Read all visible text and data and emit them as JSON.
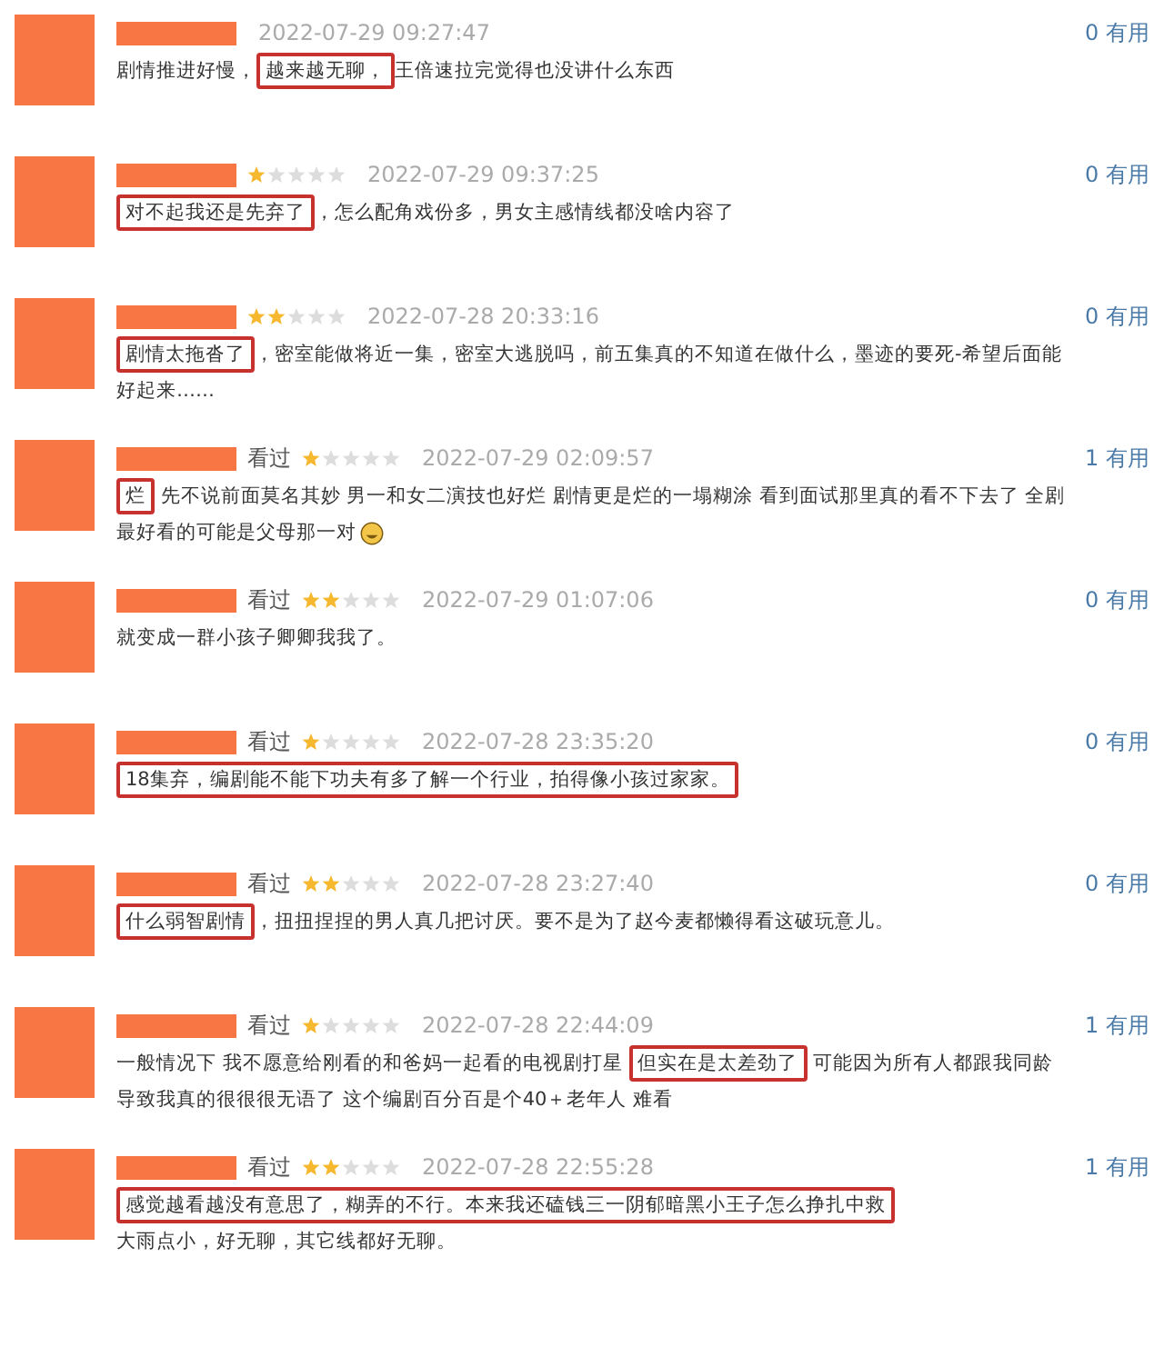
{
  "comments": [
    {
      "date": "2022-07-29 09:27:47",
      "useful": "0 有用",
      "lines": [
        {
          "segments": [
            {
              "text": "剧情推进好慢，",
              "boxed": false
            },
            {
              "text": "越来越无聊，",
              "boxed": true
            },
            {
              "text": "王倍速拉完觉得也没讲什么东西",
              "boxed": false
            }
          ]
        }
      ]
    },
    {
      "stars": 1,
      "date": "2022-07-29 09:37:25",
      "useful": "0 有用",
      "lines": [
        {
          "segments": [
            {
              "text": "对不起我还是先弃了",
              "boxed": true
            },
            {
              "text": "，怎么配角戏份多，男女主感情线都没啥内容了",
              "boxed": false
            }
          ]
        }
      ]
    },
    {
      "stars": 2,
      "date": "2022-07-28 20:33:16",
      "useful": "0 有用",
      "lines": [
        {
          "segments": [
            {
              "text": "剧情太拖沓了",
              "boxed": true
            },
            {
              "text": "，密室能做将近一集，密室大逃脱吗，前五集真的不知道在做什么，墨迹的要死-希望后面能",
              "boxed": false
            }
          ]
        },
        {
          "segments": [
            {
              "text": "好起来……",
              "boxed": false
            }
          ]
        }
      ]
    },
    {
      "watched_label": "看过",
      "stars": 1,
      "date": "2022-07-29 02:09:57",
      "useful": "1 有用",
      "lines": [
        {
          "segments": [
            {
              "text": "烂",
              "boxed": true
            },
            {
              "text": " 先不说前面莫名其妙 男一和女二演技也好烂 剧情更是烂的一塌糊涂 看到面试那里真的看不下去了 全剧",
              "boxed": false
            }
          ]
        },
        {
          "segments": [
            {
              "text": "最好看的可能是父母那一对",
              "boxed": false
            }
          ],
          "emoji": true
        }
      ]
    },
    {
      "watched_label": "看过",
      "stars": 2,
      "date": "2022-07-29 01:07:06",
      "useful": "0 有用",
      "lines": [
        {
          "segments": [
            {
              "text": "就变成一群小孩子卿卿我我了。",
              "boxed": false
            }
          ]
        }
      ]
    },
    {
      "watched_label": "看过",
      "stars": 1,
      "date": "2022-07-28 23:35:20",
      "useful": "0 有用",
      "lines": [
        {
          "segments": [
            {
              "text": "18集弃，编剧能不能下功夫有多了解一个行业，拍得像小孩过家家。",
              "boxed": true
            }
          ]
        }
      ]
    },
    {
      "watched_label": "看过",
      "stars": 2,
      "date": "2022-07-28 23:27:40",
      "useful": "0 有用",
      "lines": [
        {
          "segments": [
            {
              "text": "什么弱智剧情",
              "boxed": true
            },
            {
              "text": "，扭扭捏捏的男人真几把讨厌。要不是为了赵今麦都懒得看这破玩意儿。",
              "boxed": false
            }
          ]
        }
      ]
    },
    {
      "watched_label": "看过",
      "stars": 1,
      "date": "2022-07-28 22:44:09",
      "useful": "1 有用",
      "lines": [
        {
          "segments": [
            {
              "text": "一般情况下 我不愿意给刚看的和爸妈一起看的电视剧打星 ",
              "boxed": false
            },
            {
              "text": "但实在是太差劲了",
              "boxed": true
            },
            {
              "text": " 可能因为所有人都跟我同龄",
              "boxed": false
            }
          ]
        },
        {
          "segments": [
            {
              "text": "导致我真的很很很无语了 这个编剧百分百是个40＋老年人 难看",
              "boxed": false
            }
          ]
        }
      ]
    },
    {
      "watched_label": "看过",
      "stars": 2,
      "date": "2022-07-28 22:55:28",
      "useful": "1 有用",
      "lines": [
        {
          "segments": [
            {
              "text": "感觉越看越没有意思了，糊弄的不行。本来我还磕钱三一阴郁暗黑小王子怎么挣扎中救",
              "boxed": true
            }
          ]
        },
        {
          "segments": [
            {
              "text": "大雨点小，好无聊，其它线都好无聊。",
              "boxed": false
            }
          ]
        }
      ]
    }
  ]
}
